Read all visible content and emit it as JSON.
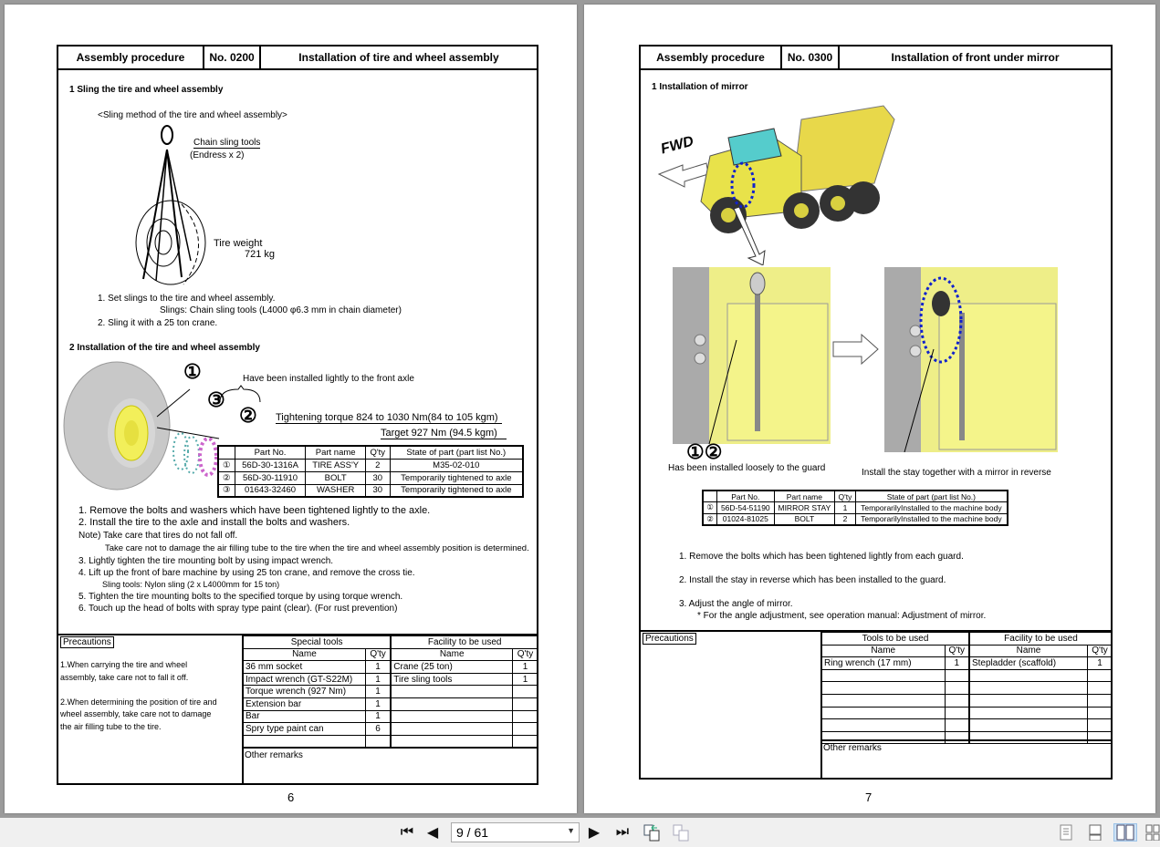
{
  "viewer": {
    "page_indicator": "9 / 61",
    "buttons": {
      "first": "first-page",
      "prev": "previous-page",
      "next": "next-page",
      "last": "last-page"
    }
  },
  "page_left": {
    "header": {
      "type": "Assembly procedure",
      "no": "No. 0200",
      "title": "Installation of tire and wheel assembly"
    },
    "section1": {
      "title": "1 Sling the tire and wheel assembly",
      "caption": "<Sling method of the tire and wheel assembly>",
      "label_tools": "Chain sling tools",
      "label_endress": "(Endress x 2)",
      "label_weight": "Tire weight",
      "label_weight_value": "721 kg",
      "steps": [
        "1. Set slings to the tire and wheel assembly.",
        "Slings: Chain sling tools (L4000 φ6.3 mm in chain diameter)",
        "2. Sling it with a 25 ton crane."
      ]
    },
    "section2": {
      "title": "2 Installation of the tire and wheel assembly",
      "callouts": [
        "①",
        "②",
        "③"
      ],
      "note_axle": "Have been installed lightly to the front axle",
      "torque": "Tightening torque 824 to 1030 Nm(84 to 105 kgm)",
      "target": "Target 927 Nm (94.5 kgm)",
      "parts_headers": [
        "Part No.",
        "Part name",
        "Q'ty",
        "State of part (part list No.)"
      ],
      "parts": [
        {
          "mark": "①",
          "part_no": "56D-30-1316A",
          "name": "TIRE ASS'Y",
          "qty": "2",
          "state": "M35-02-010"
        },
        {
          "mark": "②",
          "part_no": "56D-30-11910",
          "name": "BOLT",
          "qty": "30",
          "state": "Temporarily tightened to axle"
        },
        {
          "mark": "③",
          "part_no": "01643-32460",
          "name": "WASHER",
          "qty": "30",
          "state": "Temporarily tightened to axle"
        }
      ],
      "steps": [
        "1. Remove the bolts and washers which have been tightened lightly to the axle.",
        "2. Install the tire to the axle and install the bolts and washers.",
        "Note) Take care that tires do not fall off.",
        "Take care not to damage the air filling tube to the tire when the tire and wheel assembly position is determined.",
        "3. Lightly tighten the tire mounting bolt by using impact wrench.",
        "4. Lift up the front of bare machine by using 25 ton crane, and remove the cross tie.",
        "Sling tools: Nylon sling (2 x L4000mm for 15 ton)",
        "5. Tighten the tire mounting bolts to the specified torque by using torque wrench.",
        "6. Touch up the head of bolts with spray type paint (clear). (For rust prevention)"
      ]
    },
    "precautions": {
      "label": "Precautions",
      "items": [
        "1.When carrying the tire and wheel",
        "assembly, take care not to fall it off.",
        "2.When determining the position of tire and",
        "wheel assembly, take care not to damage",
        "the air filling tube to the tire."
      ]
    },
    "tools": {
      "left_title": "Special tools",
      "right_title": "Facility to be used",
      "col_name": "Name",
      "col_qty": "Q'ty",
      "left": [
        {
          "name": "36 mm socket",
          "qty": "1"
        },
        {
          "name": "Impact wrench (GT-S22M)",
          "qty": "1"
        },
        {
          "name": "Torque wrench (927 Nm)",
          "qty": "1"
        },
        {
          "name": "Extension bar",
          "qty": "1"
        },
        {
          "name": "Bar",
          "qty": "1"
        },
        {
          "name": "Spry type paint can",
          "qty": "6"
        }
      ],
      "right": [
        {
          "name": "Crane (25 ton)",
          "qty": "1"
        },
        {
          "name": "Tire sling tools",
          "qty": "1"
        }
      ],
      "remarks": "Other remarks"
    },
    "page_number": "6"
  },
  "page_right": {
    "header": {
      "type": "Assembly procedure",
      "no": "No. 0300",
      "title": "Installation of front under mirror"
    },
    "section1": {
      "title": "1 Installation of mirror",
      "fwd": "FWD",
      "callouts": "①②",
      "caption_left": "Has been installed loosely to the guard",
      "caption_right": "Install the stay together with a mirror in reverse",
      "parts_headers": [
        "Part No.",
        "Part name",
        "Q'ty",
        "State of part (part list No.)"
      ],
      "parts": [
        {
          "mark": "①",
          "part_no": "56D-54-51190",
          "name": "MIRROR STAY",
          "qty": "1",
          "state": "TemporarilyInstalled to the machine body"
        },
        {
          "mark": "②",
          "part_no": "01024-81025",
          "name": "BOLT",
          "qty": "2",
          "state": "TemporarilyInstalled to the machine body"
        }
      ],
      "steps": [
        "1. Remove the bolts which has been tightened lightly from each guard.",
        "2. Install the stay in reverse which has been installed to the guard.",
        "3. Adjust the angle of mirror.",
        "* For the angle adjustment, see operation manual: Adjustment of mirror."
      ]
    },
    "precautions": {
      "label": "Precautions"
    },
    "tools": {
      "left_title": "Tools to be used",
      "right_title": "Facility to be used",
      "col_name": "Name",
      "col_qty": "Q'ty",
      "left": [
        {
          "name": "Ring wrench (17 mm)",
          "qty": "1"
        }
      ],
      "right": [
        {
          "name": "Stepladder (scaffold)",
          "qty": "1"
        }
      ],
      "remarks": "Other remarks"
    },
    "page_number": "7"
  }
}
